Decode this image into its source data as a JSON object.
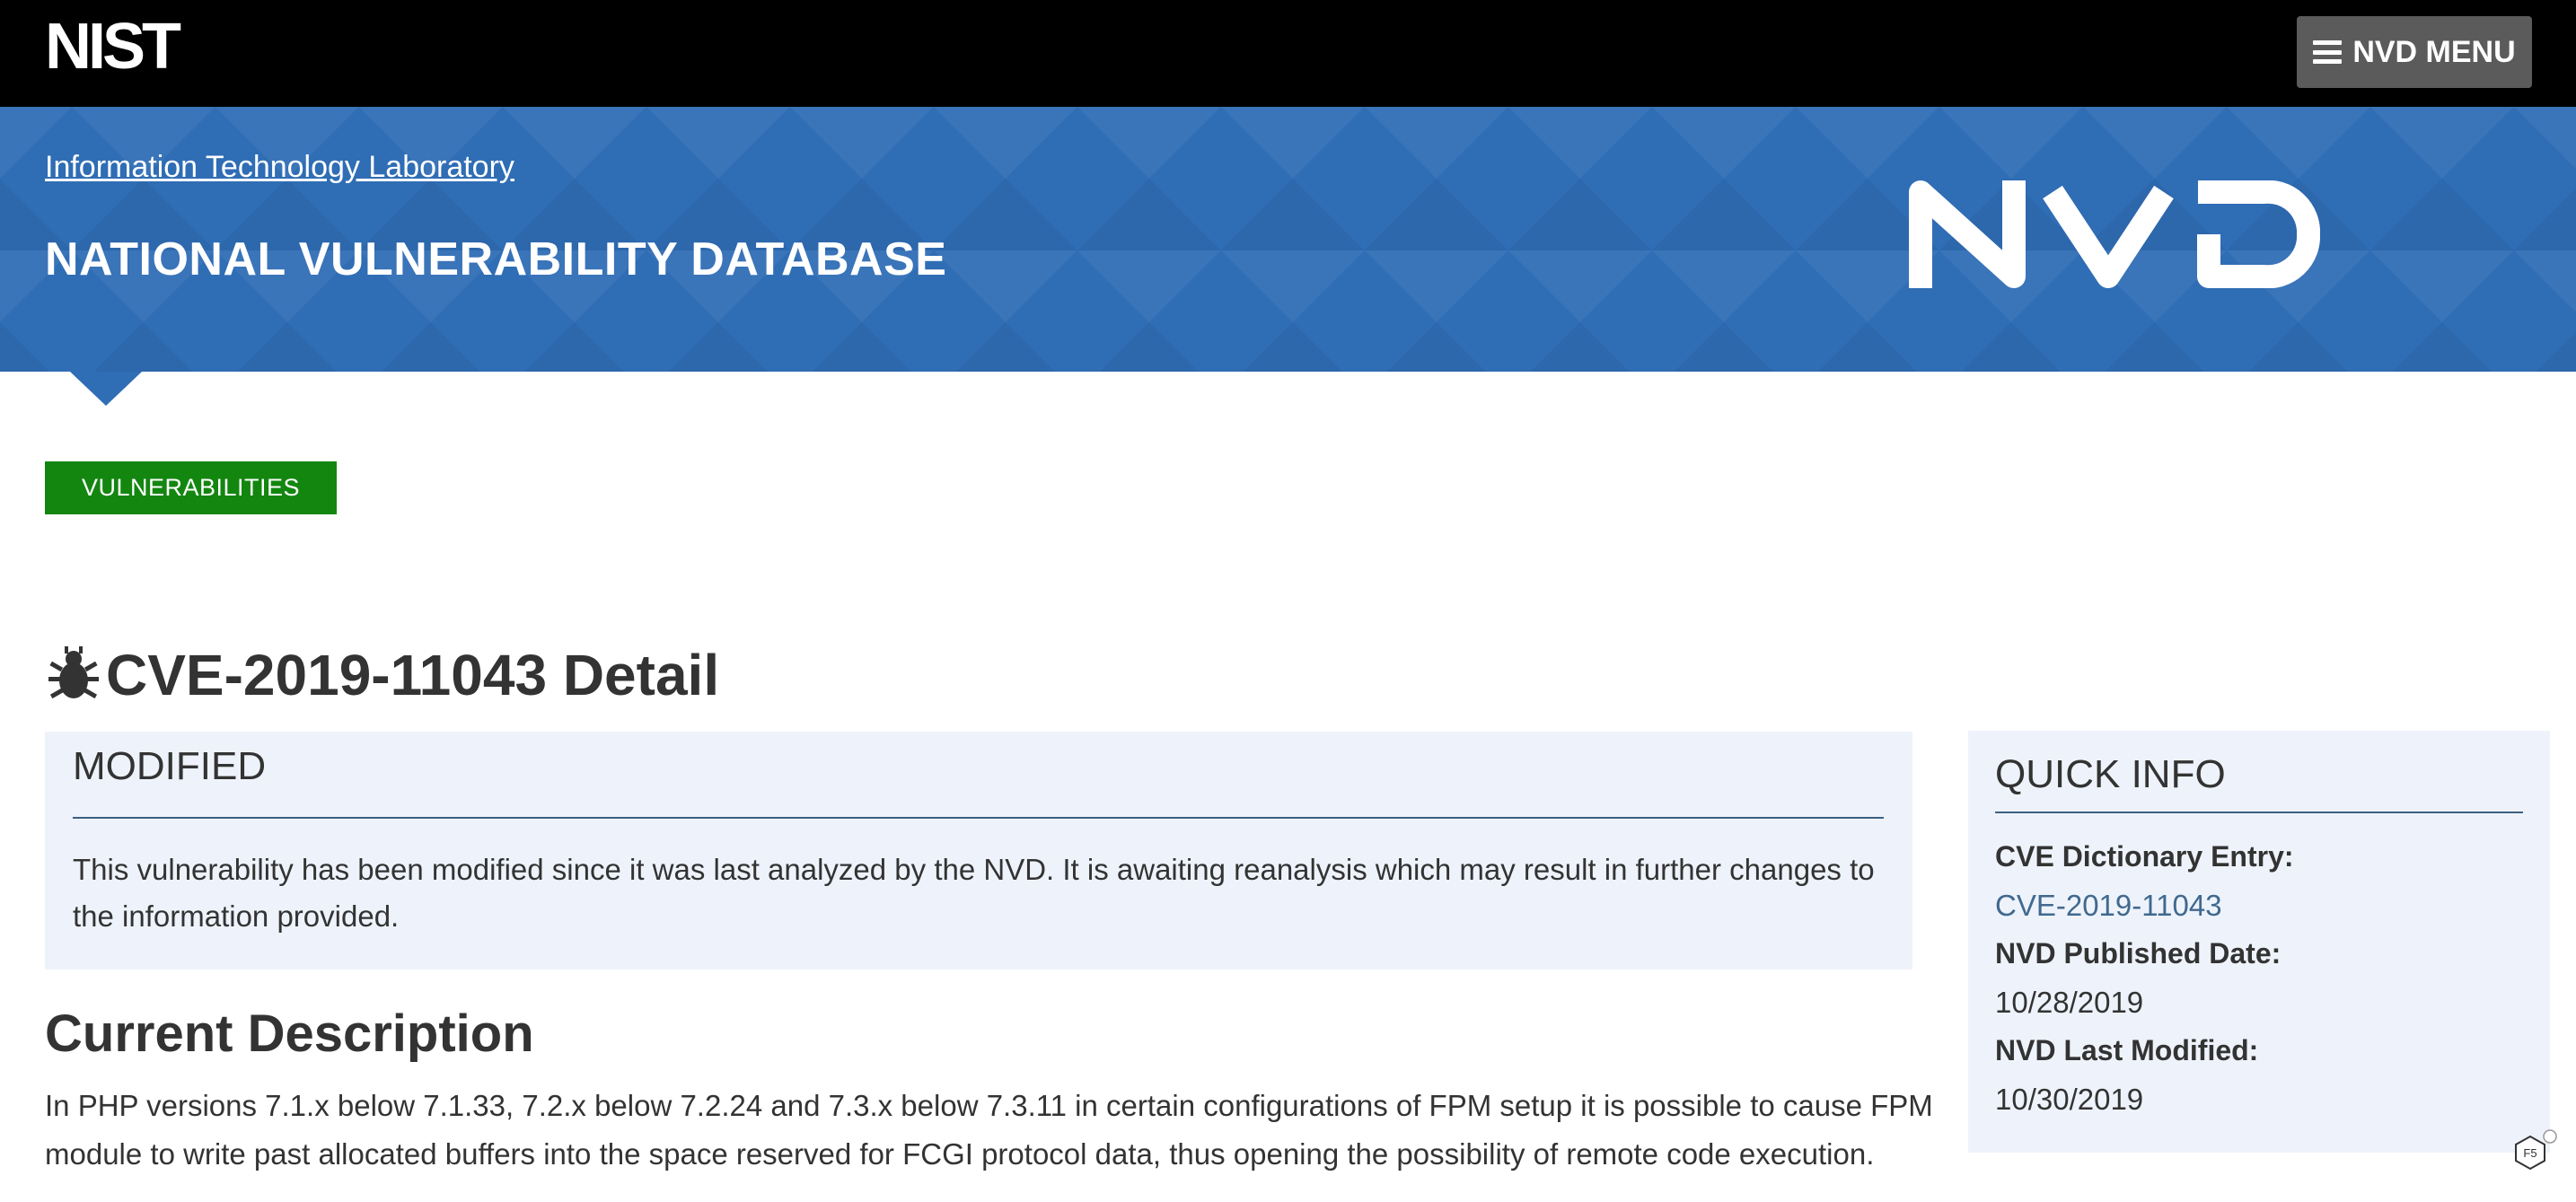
{
  "header": {
    "logo_text": "NIST",
    "menu_label": "NVD MENU",
    "menu_icon": "hamburger-icon"
  },
  "banner": {
    "itl_link": "Information Technology Laboratory",
    "title": "NATIONAL VULNERABILITY DATABASE",
    "logo_text": "NVD"
  },
  "tag": {
    "label": "VULNERABILITIES"
  },
  "page": {
    "title": "CVE-2019-11043 Detail",
    "title_icon": "bug-icon"
  },
  "modified": {
    "heading": "MODIFIED",
    "text": "This vulnerability has been modified since it was last analyzed by the NVD. It is awaiting reanalysis which may result in further changes to the information provided."
  },
  "description": {
    "heading": "Current Description",
    "text": "In PHP versions 7.1.x below 7.1.33, 7.2.x below 7.2.24 and 7.3.x below 7.3.11 in certain configurations of FPM setup it is possible to cause FPM module to write past allocated buffers into the space reserved for FCGI protocol data, thus opening the possibility of remote code execution."
  },
  "quick_info": {
    "heading": "QUICK INFO",
    "cve_label": "CVE Dictionary Entry:",
    "cve_value": "CVE-2019-11043",
    "published_label": "NVD Published Date:",
    "published_value": "10/28/2019",
    "modified_label": "NVD Last Modified:",
    "modified_value": "10/30/2019"
  },
  "badge": {
    "icon": "f5-badge-icon"
  },
  "colors": {
    "topbar": "#000000",
    "banner": "#2f6db5",
    "tag": "#138610",
    "panel": "#eef3fb",
    "link": "#41698f"
  }
}
